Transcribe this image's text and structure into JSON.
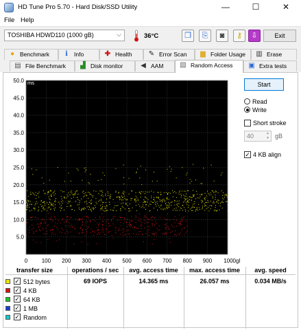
{
  "window": {
    "title": "HD Tune Pro 5.70 - Hard Disk/SSD Utility",
    "minimize": "—",
    "maximize": "☐",
    "close": "✕"
  },
  "menu": {
    "file": "File",
    "help": "Help"
  },
  "toolbar": {
    "drive": "TOSHIBA HDWD110 (1000 gB)",
    "temperature": "36°C",
    "exit_label": "Exit"
  },
  "tabs": {
    "row1": [
      "Benchmark",
      "Info",
      "Health",
      "Error Scan",
      "Folder Usage",
      "Erase"
    ],
    "row2": [
      "File Benchmark",
      "Disk monitor",
      "AAM",
      "Random Access",
      "Extra tests"
    ],
    "active": "Random Access"
  },
  "controls": {
    "start_label": "Start",
    "read_label": "Read",
    "write_label": "Write",
    "mode_selected": "Write",
    "short_stroke_label": "Short stroke",
    "short_stroke_checked": false,
    "short_stroke_value": "40",
    "short_stroke_unit": "gB",
    "align_label": "4 KB align",
    "align_checked": true
  },
  "chart_data": {
    "type": "scatter",
    "ylabel": "ms",
    "xlim": [
      0,
      1000
    ],
    "ylim": [
      0,
      50
    ],
    "x_unit": "gB",
    "x_ticks": [
      "0",
      "100",
      "200",
      "300",
      "400",
      "500",
      "600",
      "700",
      "800",
      "900",
      "1000gB"
    ],
    "y_ticks": [
      "50.0",
      "45.0",
      "40.0",
      "35.0",
      "30.0",
      "25.0",
      "20.0",
      "15.0",
      "10.0",
      "5.0"
    ],
    "grid": true,
    "background": "#000000",
    "series": [
      {
        "name": "512 bytes",
        "color": "#e8e800",
        "x_range": [
          0,
          1000
        ],
        "y_band": [
          12.5,
          18.5
        ],
        "y_outliers": [
          20,
          26
        ]
      },
      {
        "name": "4 KB",
        "color": "#d01414",
        "x_range": [
          0,
          800
        ],
        "y_band": [
          5.5,
          11.0
        ],
        "y_outliers": [
          3,
          12
        ]
      }
    ]
  },
  "results": {
    "headers": [
      "transfer size",
      "operations / sec",
      "avg. access time",
      "max. access time",
      "avg. speed"
    ],
    "rows": [
      {
        "size": "512 bytes",
        "color": "#e8e800",
        "checked": true,
        "ops": "69 IOPS",
        "avg": "14.365 ms",
        "max": "26.057 ms",
        "speed": "0.034 MB/s"
      },
      {
        "size": "4 KB",
        "color": "#d01414",
        "checked": true,
        "ops": "",
        "avg": "",
        "max": "",
        "speed": ""
      },
      {
        "size": "64 KB",
        "color": "#22c322",
        "checked": true,
        "ops": "",
        "avg": "",
        "max": "",
        "speed": ""
      },
      {
        "size": "1 MB",
        "color": "#1a3ccc",
        "checked": true,
        "ops": "",
        "avg": "",
        "max": "",
        "speed": ""
      },
      {
        "size": "Random",
        "color": "#18c8c8",
        "checked": true,
        "ops": "",
        "avg": "",
        "max": "",
        "speed": ""
      }
    ]
  }
}
